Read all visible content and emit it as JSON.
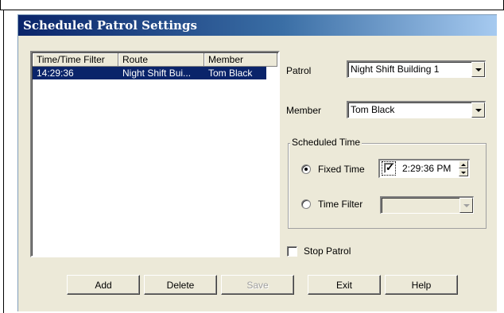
{
  "dialog": {
    "title": "Scheduled Patrol Settings"
  },
  "list": {
    "columns": [
      "Time/Time Filter",
      "Route",
      "Member"
    ],
    "rows": [
      [
        "14:29:36",
        "Night Shift Bui...",
        "Tom Black"
      ]
    ]
  },
  "form": {
    "patrol_label": "Patrol",
    "patrol_value": "Night Shift Building 1",
    "member_label": "Member",
    "member_value": "Tom Black",
    "scheduled_time_label": "Scheduled Time",
    "fixed_time_label": "Fixed Time",
    "fixed_time_selected": true,
    "fixed_time_checked": true,
    "fixed_time_value": "2:29:36 PM",
    "time_filter_label": "Time Filter",
    "time_filter_value": "",
    "stop_patrol_label": "Stop Patrol",
    "stop_patrol_checked": false
  },
  "buttons": {
    "add": "Add",
    "delete": "Delete",
    "save": "Save",
    "exit": "Exit",
    "help": "Help"
  },
  "colors": {
    "title_gradient_start": "#0a246a",
    "title_gradient_end": "#a6caf0",
    "selection": "#0a246a",
    "dialog_face": "#ece9d8"
  }
}
